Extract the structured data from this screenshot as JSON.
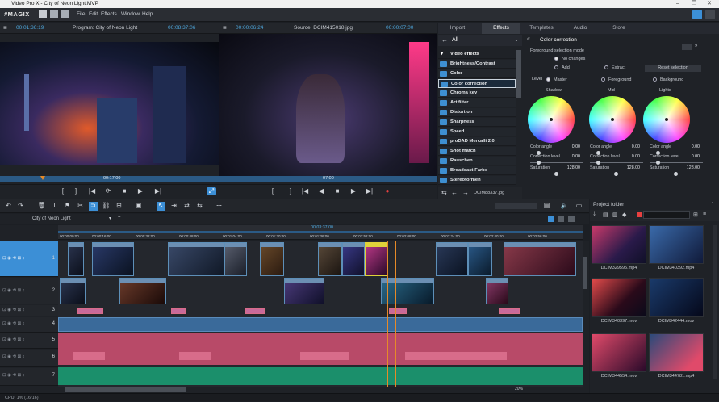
{
  "window": {
    "title": "Video Pro X - City of Neon Light.MVP"
  },
  "menu": {
    "logo": "#MAGIX",
    "items": [
      "File",
      "Edit",
      "Effects",
      "Window",
      "Help"
    ]
  },
  "program_monitor": {
    "timecode_left": "00:01:36:19",
    "title": "Program: City of Neon Light",
    "timecode_right": "00:08:37:06",
    "marker": "00:17:00"
  },
  "source_monitor": {
    "timecode_left": "00:00:06:24",
    "title": "Source: DCIM415018.jpg",
    "timecode_right": "00:00:07:00",
    "marker": "07:00"
  },
  "media_tabs": {
    "items": [
      "Import",
      "Effects",
      "Templates",
      "Audio",
      "Store"
    ],
    "active": "Effects"
  },
  "effects_panel": {
    "header": "All",
    "items": [
      "Video effects",
      "Brightness/Contrast",
      "Color",
      "Color correction",
      "Chroma key",
      "Art filter",
      "Distortion",
      "Sharpness",
      "Speed",
      "proDAD Mercalli 2.0",
      "Shot match",
      "Rauschen",
      "Broadcast-Farbe",
      "Stereoformen"
    ],
    "selected": "Color correction",
    "file_label": "DCIM88337.jpg"
  },
  "color_correction": {
    "title": "Color correction",
    "fg_mode_label": "Foreground selection mode",
    "options": [
      "No changes",
      "Add",
      "Extract"
    ],
    "reset_label": "Reset selection",
    "level_label": "Level",
    "level_options": [
      "Master",
      "Foreground",
      "Background"
    ],
    "wheels": [
      {
        "name": "Shadow",
        "angle_label": "Color angle",
        "angle": "0.00",
        "corr_label": "Correction level",
        "corr": "0.00",
        "sat_label": "Saturation",
        "sat": "128.00"
      },
      {
        "name": "Mid",
        "angle_label": "Color angle",
        "angle": "0.00",
        "corr_label": "Correction level",
        "corr": "0.00",
        "sat_label": "Saturation",
        "sat": "128.00"
      },
      {
        "name": "Lights",
        "angle_label": "Color angle",
        "angle": "0.00",
        "corr_label": "Correction level",
        "corr": "0.00",
        "sat_label": "Saturation",
        "sat": "128.00"
      }
    ]
  },
  "timeline": {
    "project_tab": "City of Neon Light",
    "playhead_time": "00:03:37:00",
    "zoom": "20%",
    "ruler": [
      "00:00:00:00",
      "00:00:16:00",
      "00:00:32:00",
      "00:00:48:00",
      "00:01:04:00",
      "00:01:20:00",
      "00:01:36:00",
      "00:01:52:00",
      "00:02:08:00",
      "00:02:24:00",
      "00:02:40:00",
      "00:02:56:00"
    ],
    "track_numbers": [
      "1",
      "2",
      "3",
      "4",
      "5",
      "6",
      "7"
    ]
  },
  "project_folder": {
    "title": "Project folder",
    "files": [
      "DCIM329595.mp4",
      "DCIM340392.mp4",
      "DCIM340397.mov",
      "DCIM342444.mov",
      "DCIM344554.mov",
      "DCIM344781.mp4"
    ]
  },
  "status": {
    "cpu": "CPU: 1% (16/16)"
  },
  "colors": {
    "accent": "#3c8fd6",
    "audio_red": "#b84a68",
    "audio_green": "#1b8f6b",
    "timecode": "#4ea8de"
  }
}
